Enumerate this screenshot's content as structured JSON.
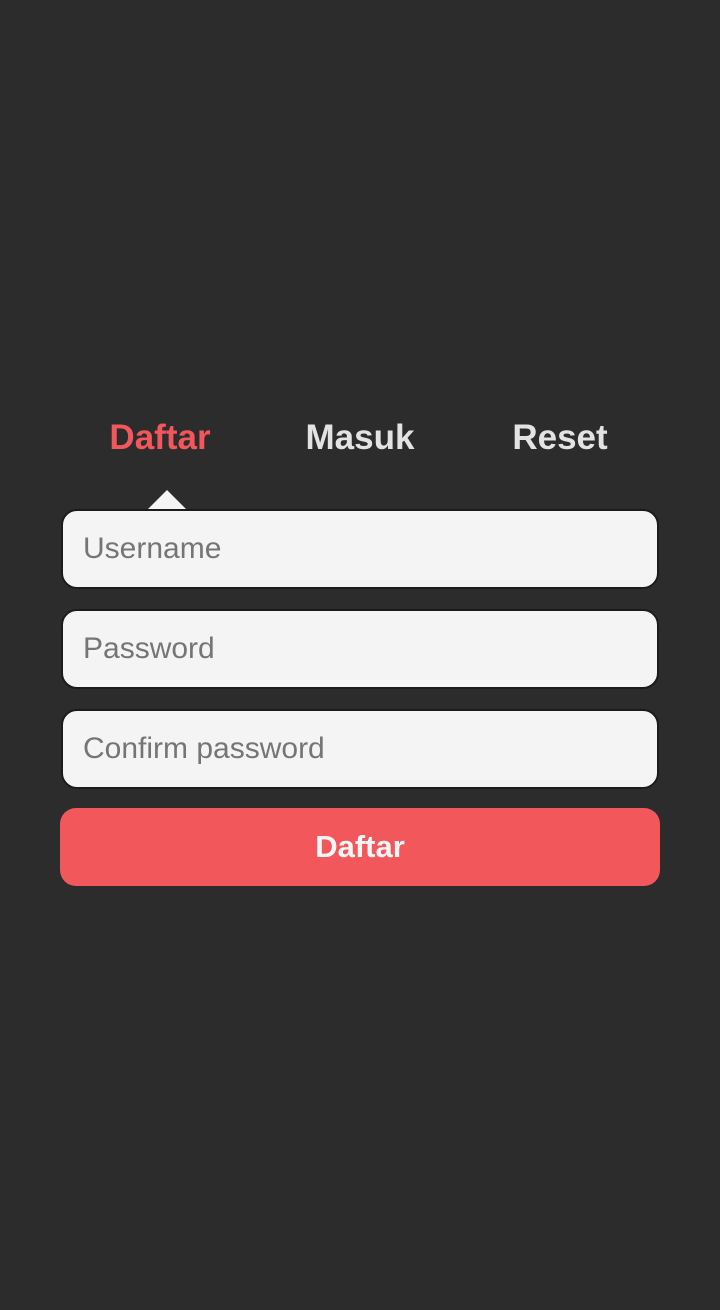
{
  "tabs": {
    "items": [
      {
        "label": "Daftar",
        "active": true
      },
      {
        "label": "Masuk",
        "active": false
      },
      {
        "label": "Reset",
        "active": false
      }
    ]
  },
  "form": {
    "username": {
      "value": "",
      "placeholder": "Username"
    },
    "password": {
      "value": "",
      "placeholder": "Password"
    },
    "confirm_password": {
      "value": "",
      "placeholder": "Confirm password"
    },
    "submit_label": "Daftar"
  },
  "colors": {
    "background": "#2c2c2c",
    "accent": "#f2575b",
    "field_background": "#f4f4f4",
    "tab_text": "#e3e3e3"
  }
}
